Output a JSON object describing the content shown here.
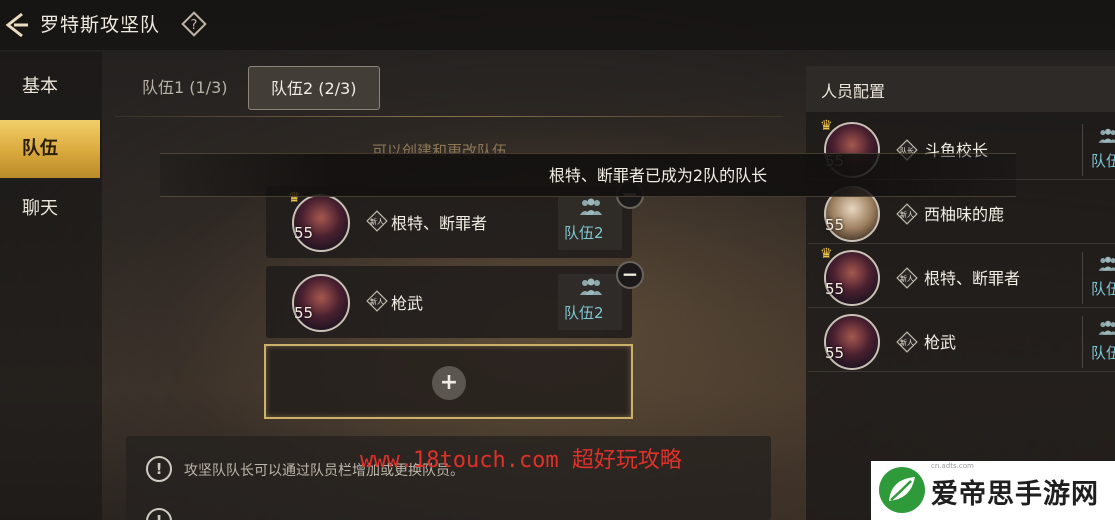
{
  "header": {
    "title": "罗特斯攻坚队"
  },
  "sidebar": {
    "items": [
      {
        "label": "基本"
      },
      {
        "label": "队伍"
      },
      {
        "label": "聊天"
      }
    ],
    "active_index": 1
  },
  "tabs": [
    {
      "label": "队伍1 (1/3)"
    },
    {
      "label": "队伍2 (2/3)"
    }
  ],
  "hint": "可以创建和更改队伍",
  "toast": "根特、断罪者已成为2队的队长",
  "team_members": [
    {
      "level": "55",
      "badge": "新人",
      "name": "根特、断罪者",
      "team": "队伍2",
      "is_leader": true
    },
    {
      "level": "55",
      "badge": "新人",
      "name": "枪武",
      "team": "队伍2",
      "is_leader": false
    }
  ],
  "info": [
    "攻坚队队长可以通过队员栏增加或更换队员。"
  ],
  "watermark": "www.18touch.com 超好玩攻略",
  "roster": {
    "title": "人员配置",
    "members": [
      {
        "level": "55",
        "badge": "队长",
        "name": "斗鱼校长",
        "team": "队伍",
        "is_leader": true
      },
      {
        "level": "55",
        "badge": "新人",
        "name": "西柚味的鹿",
        "team": "",
        "is_leader": false
      },
      {
        "level": "55",
        "badge": "新人",
        "name": "根特、断罪者",
        "team": "队伍",
        "is_leader": true
      },
      {
        "level": "55",
        "badge": "新人",
        "name": "枪武",
        "team": "队伍",
        "is_leader": false
      }
    ]
  },
  "logo": {
    "text": "爱帝思手游网",
    "sub": "cn.adts.com"
  },
  "colors": {
    "accent_gold": "#d9a93c",
    "team_label": "#7ec7d3",
    "watermark_red": "#e0302a"
  }
}
